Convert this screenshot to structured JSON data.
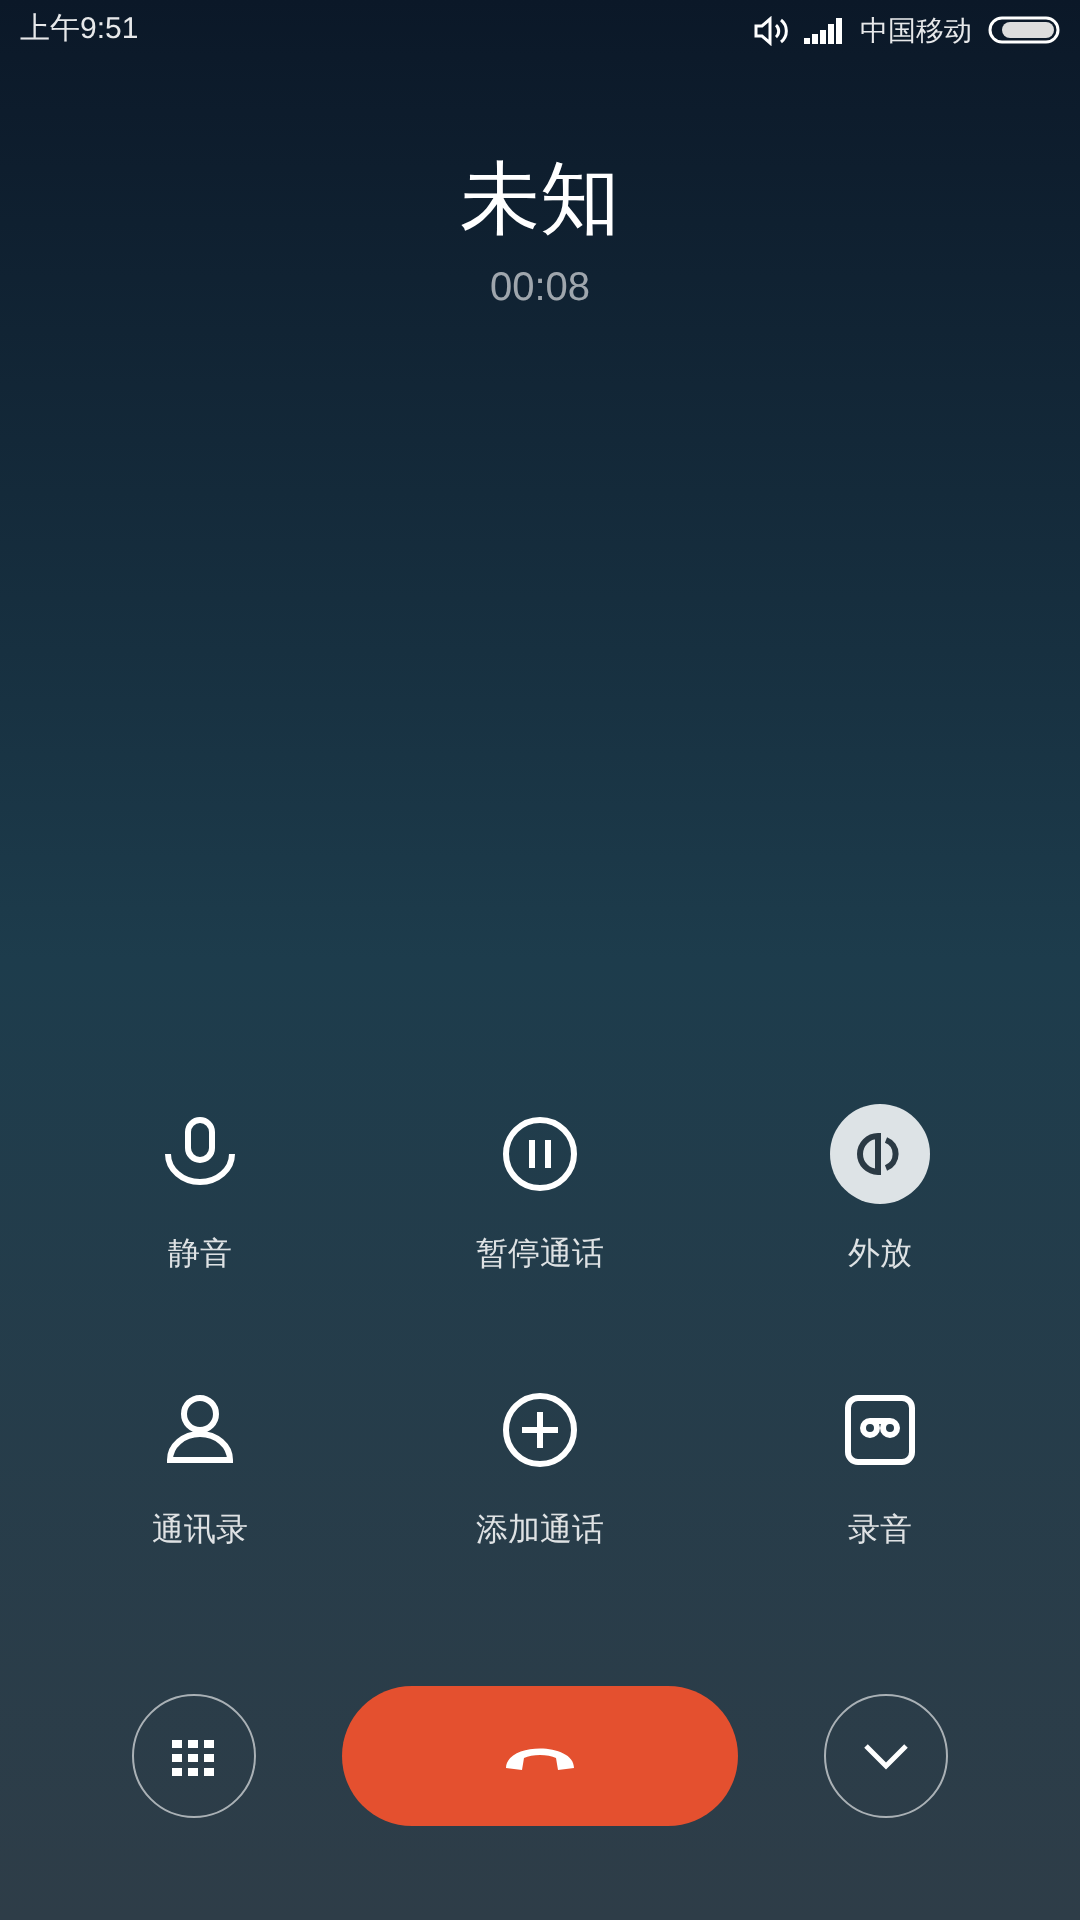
{
  "status_bar": {
    "time": "上午9:51",
    "carrier": "中国移动"
  },
  "call": {
    "caller": "未知",
    "duration": "00:08"
  },
  "actions": [
    {
      "kind": "mute",
      "label": "静音",
      "on": false
    },
    {
      "kind": "hold",
      "label": "暂停通话",
      "on": false
    },
    {
      "kind": "speaker",
      "label": "外放",
      "on": true
    },
    {
      "kind": "contacts",
      "label": "通讯录",
      "on": false
    },
    {
      "kind": "add",
      "label": "添加通话",
      "on": false
    },
    {
      "kind": "record",
      "label": "录音",
      "on": false
    }
  ]
}
